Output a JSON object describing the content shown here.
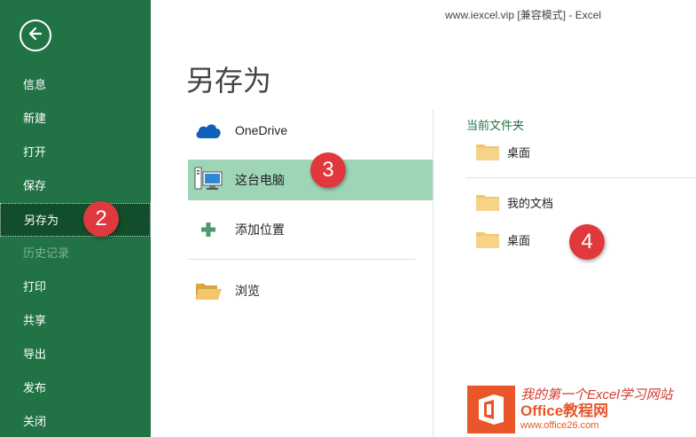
{
  "window": {
    "title": "www.iexcel.vip  [兼容模式]  -  Excel"
  },
  "sidebar": {
    "back_label": "",
    "items": [
      {
        "label": "信息",
        "state": "normal"
      },
      {
        "label": "新建",
        "state": "normal"
      },
      {
        "label": "打开",
        "state": "normal"
      },
      {
        "label": "保存",
        "state": "normal"
      },
      {
        "label": "另存为",
        "state": "active"
      },
      {
        "label": "历史记录",
        "state": "disabled"
      },
      {
        "label": "打印",
        "state": "normal"
      },
      {
        "label": "共享",
        "state": "normal"
      },
      {
        "label": "导出",
        "state": "normal"
      },
      {
        "label": "发布",
        "state": "normal"
      },
      {
        "label": "关闭",
        "state": "normal"
      }
    ]
  },
  "page_title": "另存为",
  "locations": [
    {
      "label": "OneDrive",
      "icon": "cloud-icon"
    },
    {
      "label": "这台电脑",
      "icon": "computer-icon",
      "selected": true
    },
    {
      "label": "添加位置",
      "icon": "plus-icon"
    },
    {
      "label": "浏览",
      "icon": "folder-open-icon"
    }
  ],
  "current_folder": {
    "heading": "当前文件夹",
    "items": [
      {
        "label": "桌面"
      }
    ]
  },
  "recent_folders": {
    "items": [
      {
        "label": "我的文档"
      },
      {
        "label": "桌面"
      }
    ]
  },
  "badges": [
    "2",
    "3",
    "4"
  ],
  "watermark": {
    "line1": "我的第一个Excel学习网站",
    "line2": "Office教程网",
    "line3": "www.office26.com"
  },
  "colors": {
    "sidebar": "#217346",
    "sidebar_active": "#124e2c",
    "selected_location": "#9fd5b7",
    "accent_text": "#217346",
    "badge": "#e0383c",
    "folder": "#f2c76b",
    "onedrive": "#0f5fb8"
  }
}
